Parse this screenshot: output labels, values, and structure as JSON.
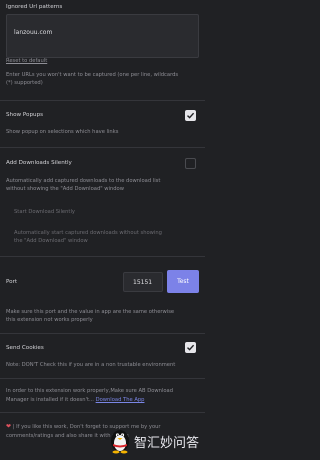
{
  "ignored": {
    "title": "Ignored Url patterns",
    "value": "lanzouu.com",
    "reset": "Reset to default",
    "help_1": "Enter URLs you won't want to be captured (one per line, wildcards",
    "help_2": "(*) supported)"
  },
  "popups": {
    "title": "Show Popups",
    "checked": true,
    "help": "Show popup on selections which have links"
  },
  "silent": {
    "title": "Add Downloads Silently",
    "checked": false,
    "help_1": "Automatically add captured downloads to the download list",
    "help_2": "without showing the \"Add Download\" window"
  },
  "start_silent": {
    "title": "Start Download Silently",
    "help_1": "Automatically start captured downloads without showing",
    "help_2": "the \"Add Download\" window"
  },
  "port": {
    "title": "Port",
    "value": "15151",
    "button": "Test",
    "help_1": "Make sure this port and the value in app are the same otherwise",
    "help_2": "this extension not works properly"
  },
  "cookies": {
    "title": "Send Cookies",
    "checked": true,
    "help": "Note: DON'T Check this if you are in a non trustable environment"
  },
  "footer": {
    "info_1": "In order to this extension work properly,Make sure AB Download",
    "info_2_prefix": "Manager is installed if it doesn't... ",
    "download_link": "Download The App",
    "support_prefix": "| If you like this work, Don't forget to support me by your",
    "support_2": "comments/ratings and also share it with others"
  },
  "watermark": "智汇妙问答"
}
